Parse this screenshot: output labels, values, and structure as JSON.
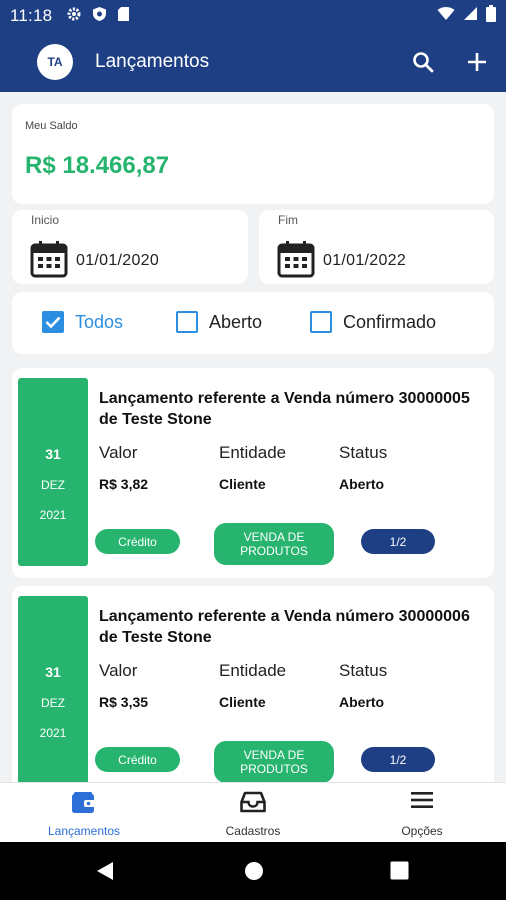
{
  "status_bar": {
    "time": "11:18",
    "left_icons": [
      "gear-icon",
      "shield-icon",
      "sd-card-icon"
    ],
    "right_icons": [
      "wifi-icon",
      "signal-icon",
      "battery-icon"
    ]
  },
  "app_bar": {
    "avatar_initials": "TA",
    "title": "Lançamentos",
    "actions": [
      "search-icon",
      "add-icon"
    ]
  },
  "balance": {
    "label": "Meu Saldo",
    "value": "R$ 18.466,87"
  },
  "date_range": {
    "start": {
      "label": "Inicio",
      "value": "01/01/2020"
    },
    "end": {
      "label": "Fim",
      "value": "01/01/2022"
    }
  },
  "filters": [
    {
      "label": "Todos",
      "checked": true
    },
    {
      "label": "Aberto",
      "checked": false
    },
    {
      "label": "Confirmado",
      "checked": false
    }
  ],
  "entries": [
    {
      "day": "31",
      "month": "DEZ",
      "year": "2021",
      "title": "Lançamento referente a Venda número 30000005 de Teste Stone",
      "col_labels": [
        "Valor",
        "Entidade",
        "Status"
      ],
      "valor": "R$ 3,82",
      "entidade": "Cliente",
      "status": "Aberto",
      "type_tag": "Crédito",
      "category_tag": "VENDA DE PRODUTOS",
      "installment": "1/2"
    },
    {
      "day": "31",
      "month": "DEZ",
      "year": "2021",
      "title": "Lançamento referente a Venda número 30000006 de Teste Stone",
      "col_labels": [
        "Valor",
        "Entidade",
        "Status"
      ],
      "valor": "R$ 3,35",
      "entidade": "Cliente",
      "status": "Aberto",
      "type_tag": "Crédito",
      "category_tag": "VENDA DE PRODUTOS",
      "installment": "1/2"
    }
  ],
  "bottom_nav": [
    {
      "label": "Lançamentos",
      "icon": "wallet-icon",
      "active": true
    },
    {
      "label": "Cadastros",
      "icon": "inbox-icon",
      "active": false
    },
    {
      "label": "Opções",
      "icon": "menu-icon",
      "active": false
    }
  ],
  "colors": {
    "primary": "#1f3f85",
    "accent_green": "#27b46e",
    "checkbox_blue": "#2c8ee0",
    "nav_active": "#2c6fd6"
  }
}
